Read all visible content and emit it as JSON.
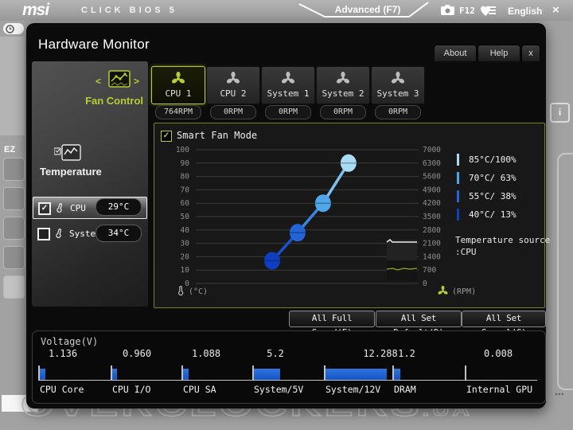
{
  "topbar": {
    "logo": "msi",
    "brand": "CLICK BIOS 5",
    "advanced": "Advanced (F7)",
    "screenshot_key": "F12",
    "language": "English",
    "close": "×"
  },
  "background": {
    "ez": "EZ",
    "info": "i",
    "dots": "...",
    "watermark": "OVERCLOCKERS",
    "watermark_suffix": ".UA"
  },
  "window": {
    "title": "Hardware Monitor",
    "tab_about": "About",
    "tab_help": "Help",
    "tab_close": "x"
  },
  "sidebar": {
    "fan_control": "Fan Control",
    "arrow_left": "<",
    "arrow_right": ">",
    "temperature": "Temperature",
    "sensors": [
      {
        "label": "CPU",
        "value": "29°C",
        "checked": true
      },
      {
        "label": "System",
        "value": "34°C",
        "checked": false
      }
    ]
  },
  "fan_tabs": [
    {
      "label": "CPU 1",
      "rpm": "764RPM",
      "active": true
    },
    {
      "label": "CPU 2",
      "rpm": "0RPM",
      "active": false
    },
    {
      "label": "System 1",
      "rpm": "0RPM",
      "active": false
    },
    {
      "label": "System 2",
      "rpm": "0RPM",
      "active": false
    },
    {
      "label": "System 3",
      "rpm": "0RPM",
      "active": false
    }
  ],
  "chart_data": {
    "type": "line",
    "title": "Smart Fan Mode",
    "smart_fan_enabled": true,
    "xlabel": "(°C)",
    "right_axis_label": "(RPM)",
    "left_axis": {
      "min": 0,
      "max": 100,
      "step": 10
    },
    "right_axis": {
      "min": 0,
      "max": 7000,
      "step": 700
    },
    "grid": true,
    "legend_position": "right",
    "points": [
      {
        "temp": 40,
        "duty_pct": 13,
        "plotted_pct": 17,
        "color": "#0e3fc0"
      },
      {
        "temp": 55,
        "duty_pct": 38,
        "plotted_pct": 38,
        "color": "#2365d8"
      },
      {
        "temp": 70,
        "duty_pct": 63,
        "plotted_pct": 60,
        "color": "#4fa6e8"
      },
      {
        "temp": 85,
        "duty_pct": 100,
        "plotted_pct": 90,
        "color": "#a9dbf5"
      }
    ],
    "legend": [
      {
        "label": "85°C/100%",
        "color": "#a9dbf5"
      },
      {
        "label": "70°C/ 63%",
        "color": "#4fa6e8"
      },
      {
        "label": "55°C/ 38%",
        "color": "#2365d8"
      },
      {
        "label": "40°C/ 13%",
        "color": "#0e3fc0"
      }
    ],
    "history_graph": {
      "top_line_rpm": 2100,
      "current_line_rpm": 760
    },
    "temperature_source_line1": "Temperature source",
    "temperature_source_line2": ":CPU"
  },
  "actions": {
    "full_speed": "All Full Speed(F)",
    "set_default": "All Set Default(D)",
    "set_cancel": "All Set Cancel(C)"
  },
  "voltage": {
    "title": "Voltage(V)",
    "rails": [
      {
        "label": "CPU Core",
        "value": "1.136"
      },
      {
        "label": "CPU I/O",
        "value": "0.960"
      },
      {
        "label": "CPU SA",
        "value": "1.088"
      },
      {
        "label": "System/5V",
        "value": "5.2"
      },
      {
        "label": "System/12V",
        "value": "12.288"
      },
      {
        "label": "DRAM",
        "value": "1.2"
      },
      {
        "label": "Internal GPU",
        "value": "0.008"
      }
    ]
  }
}
